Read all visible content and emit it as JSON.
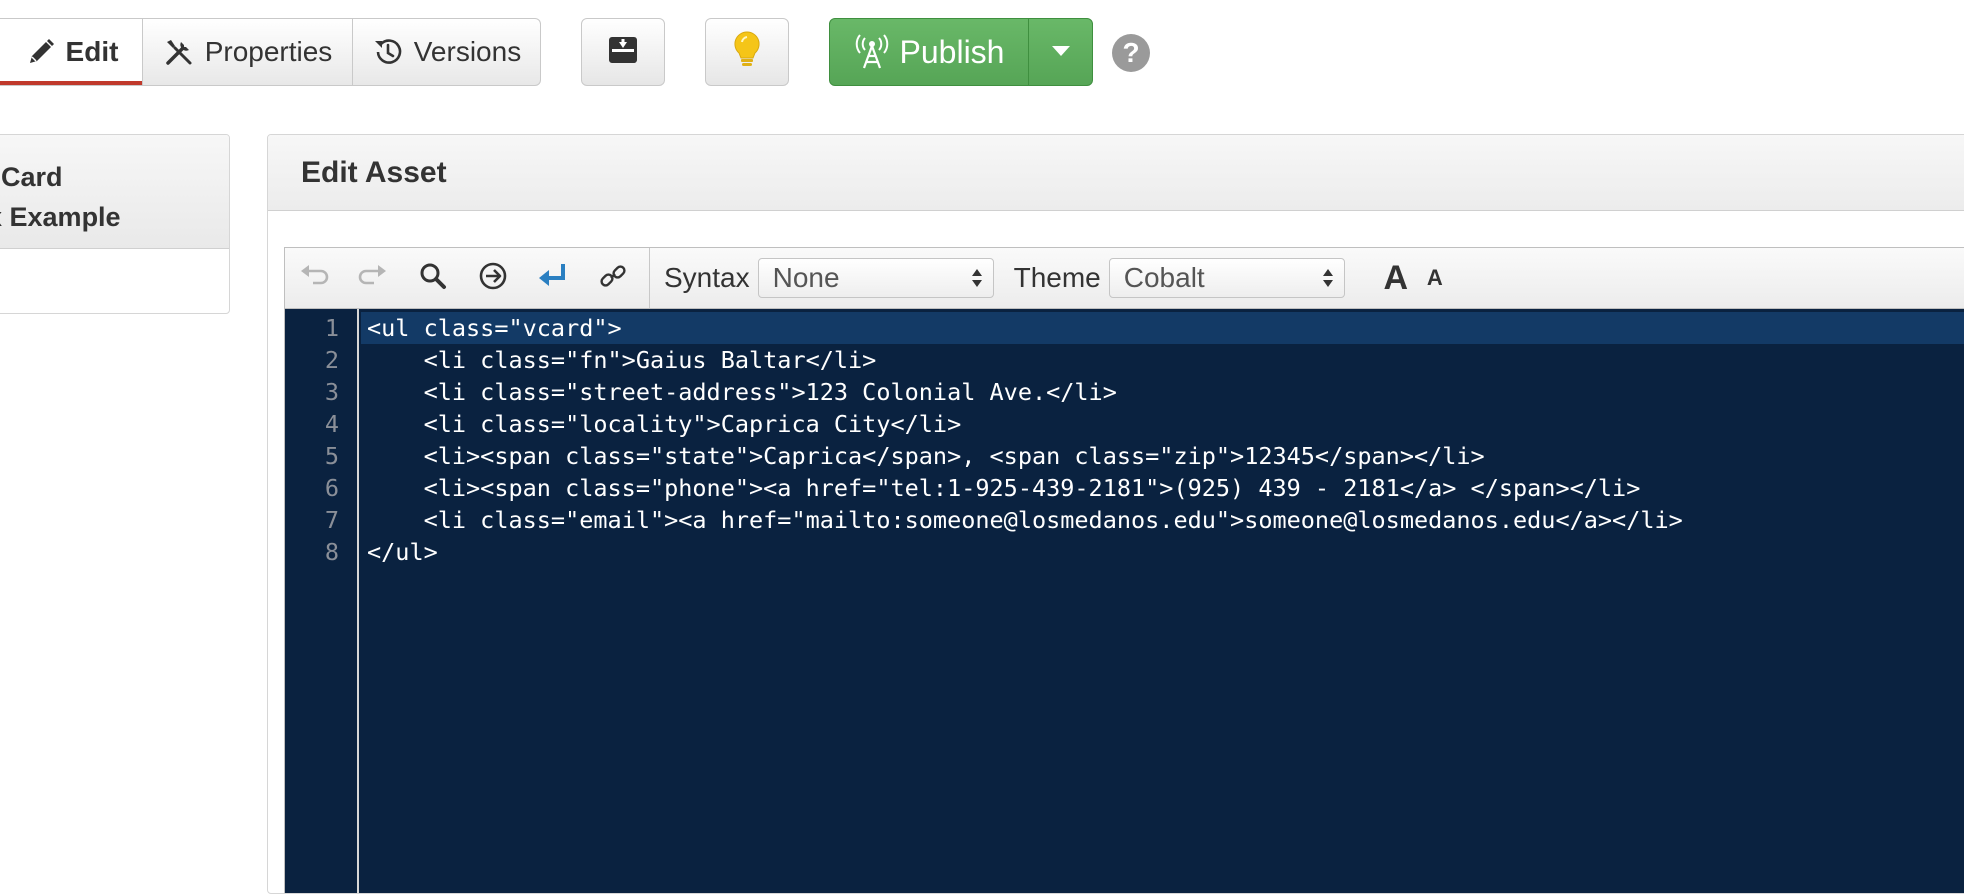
{
  "toolbar": {
    "tabs": {
      "edit": "Edit",
      "properties": "Properties",
      "versions": "Versions"
    },
    "archive_icon": "archive-download-icon",
    "tip_icon": "lightbulb-icon",
    "publish_label": "Publish",
    "help_label": "?"
  },
  "side_panel": {
    "line1": "Card",
    "line2": "x Example"
  },
  "main": {
    "title": "Edit Asset"
  },
  "editor": {
    "syntax_label": "Syntax",
    "syntax_value": "None",
    "theme_label": "Theme",
    "theme_value": "Cobalt",
    "font_increase": "A",
    "font_decrease": "A",
    "line_numbers": [
      "1",
      "2",
      "3",
      "4",
      "5",
      "6",
      "7",
      "8"
    ],
    "lines": [
      "<ul class=\"vcard\">",
      "    <li class=\"fn\">Gaius Baltar</li>",
      "    <li class=\"street-address\">123 Colonial Ave.</li>",
      "    <li class=\"locality\">Caprica City</li>",
      "    <li><span class=\"state\">Caprica</span>, <span class=\"zip\">12345</span></li>",
      "    <li><span class=\"phone\"><a href=\"tel:1-925-439-2181\">(925) 439 - 2181</a> </span></li>",
      "    <li class=\"email\"><a href=\"mailto:someone@losmedanos.edu\">someone@losmedanos.edu</a></li>",
      "</ul>"
    ]
  },
  "colors": {
    "publish_green": "#5cb85c",
    "edit_underline": "#c0392b",
    "editor_bg": "#0a2240",
    "active_line": "#133a66",
    "lightbulb": "#f5c518",
    "redo_blue": "#2a7fc1"
  }
}
